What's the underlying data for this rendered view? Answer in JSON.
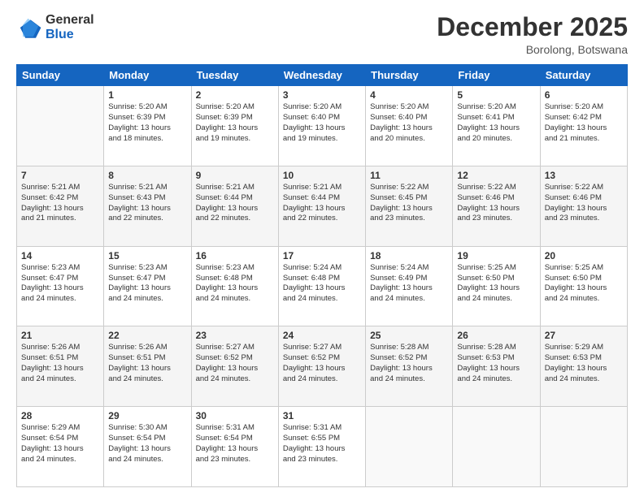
{
  "logo": {
    "line1": "General",
    "line2": "Blue"
  },
  "header": {
    "month": "December 2025",
    "location": "Borolong, Botswana"
  },
  "days": [
    "Sunday",
    "Monday",
    "Tuesday",
    "Wednesday",
    "Thursday",
    "Friday",
    "Saturday"
  ],
  "weeks": [
    [
      {
        "day": "",
        "info": ""
      },
      {
        "day": "1",
        "info": "Sunrise: 5:20 AM\nSunset: 6:39 PM\nDaylight: 13 hours\nand 18 minutes."
      },
      {
        "day": "2",
        "info": "Sunrise: 5:20 AM\nSunset: 6:39 PM\nDaylight: 13 hours\nand 19 minutes."
      },
      {
        "day": "3",
        "info": "Sunrise: 5:20 AM\nSunset: 6:40 PM\nDaylight: 13 hours\nand 19 minutes."
      },
      {
        "day": "4",
        "info": "Sunrise: 5:20 AM\nSunset: 6:40 PM\nDaylight: 13 hours\nand 20 minutes."
      },
      {
        "day": "5",
        "info": "Sunrise: 5:20 AM\nSunset: 6:41 PM\nDaylight: 13 hours\nand 20 minutes."
      },
      {
        "day": "6",
        "info": "Sunrise: 5:20 AM\nSunset: 6:42 PM\nDaylight: 13 hours\nand 21 minutes."
      }
    ],
    [
      {
        "day": "7",
        "info": "Sunrise: 5:21 AM\nSunset: 6:42 PM\nDaylight: 13 hours\nand 21 minutes."
      },
      {
        "day": "8",
        "info": "Sunrise: 5:21 AM\nSunset: 6:43 PM\nDaylight: 13 hours\nand 22 minutes."
      },
      {
        "day": "9",
        "info": "Sunrise: 5:21 AM\nSunset: 6:44 PM\nDaylight: 13 hours\nand 22 minutes."
      },
      {
        "day": "10",
        "info": "Sunrise: 5:21 AM\nSunset: 6:44 PM\nDaylight: 13 hours\nand 22 minutes."
      },
      {
        "day": "11",
        "info": "Sunrise: 5:22 AM\nSunset: 6:45 PM\nDaylight: 13 hours\nand 23 minutes."
      },
      {
        "day": "12",
        "info": "Sunrise: 5:22 AM\nSunset: 6:46 PM\nDaylight: 13 hours\nand 23 minutes."
      },
      {
        "day": "13",
        "info": "Sunrise: 5:22 AM\nSunset: 6:46 PM\nDaylight: 13 hours\nand 23 minutes."
      }
    ],
    [
      {
        "day": "14",
        "info": "Sunrise: 5:23 AM\nSunset: 6:47 PM\nDaylight: 13 hours\nand 24 minutes."
      },
      {
        "day": "15",
        "info": "Sunrise: 5:23 AM\nSunset: 6:47 PM\nDaylight: 13 hours\nand 24 minutes."
      },
      {
        "day": "16",
        "info": "Sunrise: 5:23 AM\nSunset: 6:48 PM\nDaylight: 13 hours\nand 24 minutes."
      },
      {
        "day": "17",
        "info": "Sunrise: 5:24 AM\nSunset: 6:48 PM\nDaylight: 13 hours\nand 24 minutes."
      },
      {
        "day": "18",
        "info": "Sunrise: 5:24 AM\nSunset: 6:49 PM\nDaylight: 13 hours\nand 24 minutes."
      },
      {
        "day": "19",
        "info": "Sunrise: 5:25 AM\nSunset: 6:50 PM\nDaylight: 13 hours\nand 24 minutes."
      },
      {
        "day": "20",
        "info": "Sunrise: 5:25 AM\nSunset: 6:50 PM\nDaylight: 13 hours\nand 24 minutes."
      }
    ],
    [
      {
        "day": "21",
        "info": "Sunrise: 5:26 AM\nSunset: 6:51 PM\nDaylight: 13 hours\nand 24 minutes."
      },
      {
        "day": "22",
        "info": "Sunrise: 5:26 AM\nSunset: 6:51 PM\nDaylight: 13 hours\nand 24 minutes."
      },
      {
        "day": "23",
        "info": "Sunrise: 5:27 AM\nSunset: 6:52 PM\nDaylight: 13 hours\nand 24 minutes."
      },
      {
        "day": "24",
        "info": "Sunrise: 5:27 AM\nSunset: 6:52 PM\nDaylight: 13 hours\nand 24 minutes."
      },
      {
        "day": "25",
        "info": "Sunrise: 5:28 AM\nSunset: 6:52 PM\nDaylight: 13 hours\nand 24 minutes."
      },
      {
        "day": "26",
        "info": "Sunrise: 5:28 AM\nSunset: 6:53 PM\nDaylight: 13 hours\nand 24 minutes."
      },
      {
        "day": "27",
        "info": "Sunrise: 5:29 AM\nSunset: 6:53 PM\nDaylight: 13 hours\nand 24 minutes."
      }
    ],
    [
      {
        "day": "28",
        "info": "Sunrise: 5:29 AM\nSunset: 6:54 PM\nDaylight: 13 hours\nand 24 minutes."
      },
      {
        "day": "29",
        "info": "Sunrise: 5:30 AM\nSunset: 6:54 PM\nDaylight: 13 hours\nand 24 minutes."
      },
      {
        "day": "30",
        "info": "Sunrise: 5:31 AM\nSunset: 6:54 PM\nDaylight: 13 hours\nand 23 minutes."
      },
      {
        "day": "31",
        "info": "Sunrise: 5:31 AM\nSunset: 6:55 PM\nDaylight: 13 hours\nand 23 minutes."
      },
      {
        "day": "",
        "info": ""
      },
      {
        "day": "",
        "info": ""
      },
      {
        "day": "",
        "info": ""
      }
    ]
  ]
}
